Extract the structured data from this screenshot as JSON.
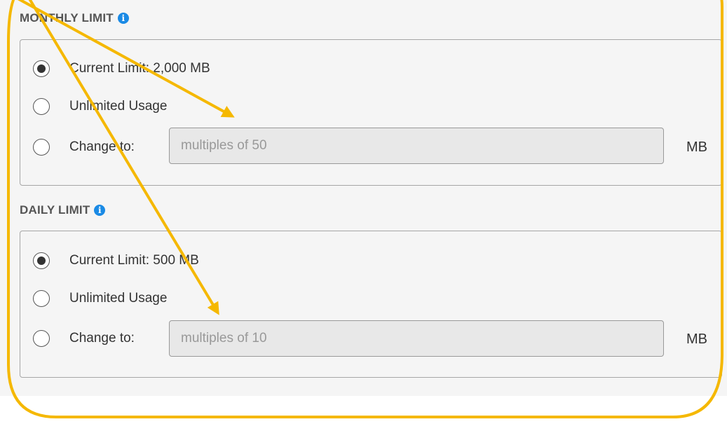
{
  "monthly": {
    "title": "MONTHLY LIMIT",
    "info_icon": "info-icon",
    "current_limit": "Current Limit: 2,000 MB",
    "unlimited": "Unlimited Usage",
    "change_to": "Change to:",
    "input_placeholder": "multiples of 50",
    "input_value": "",
    "unit": "MB",
    "selected": "current"
  },
  "daily": {
    "title": "DAILY LIMIT",
    "info_icon": "info-icon",
    "current_limit": "Current Limit: 500 MB",
    "unlimited": "Unlimited Usage",
    "change_to": "Change to:",
    "input_placeholder": "multiples of 10",
    "input_value": "",
    "unit": "MB",
    "selected": "current"
  },
  "colors": {
    "annotation": "#f5b800",
    "info": "#1a8ae5"
  }
}
